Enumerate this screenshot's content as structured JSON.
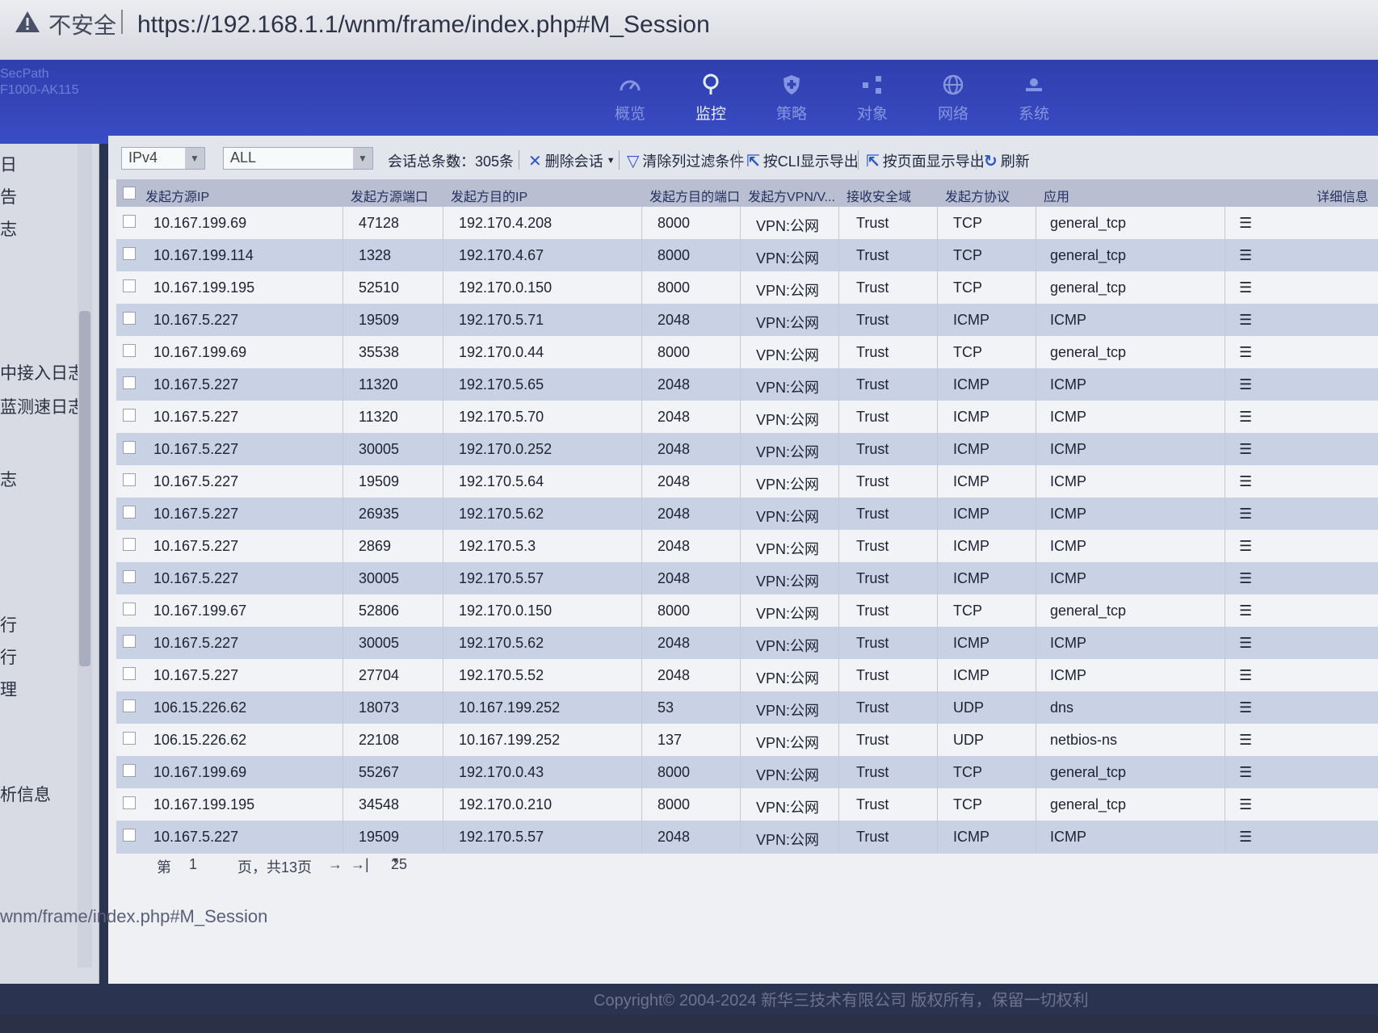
{
  "browser": {
    "insecure_label": "不安全",
    "url": "https://192.168.1.1/wnm/frame/index.php#M_Session"
  },
  "app": {
    "brand_line1": "SecPath",
    "brand_line2": "F1000-AK115"
  },
  "nav": [
    {
      "label": "概览",
      "icon": "dashboard-icon",
      "active": false
    },
    {
      "label": "监控",
      "icon": "location-pin-icon",
      "active": true
    },
    {
      "label": "策略",
      "icon": "shield-icon",
      "active": false
    },
    {
      "label": "对象",
      "icon": "network-nodes-icon",
      "active": false
    },
    {
      "label": "网络",
      "icon": "globe-icon",
      "active": false
    },
    {
      "label": "系统",
      "icon": "system-icon",
      "active": false
    }
  ],
  "sidebar": {
    "items": [
      "日",
      "告",
      "志",
      "中接入日志",
      "蓝测速日志",
      "志",
      "行",
      "行",
      "理",
      "析信息"
    ]
  },
  "toolbar": {
    "ip_version": "IPv4",
    "filter": "ALL",
    "session_count_label": "会话总条数",
    "session_count_value": "：305条",
    "delete_label": "删除会话",
    "clear_filter_label": "清除列过滤条件",
    "export_cli_label": "按CLI显示导出",
    "export_page_label": "按页面显示导出",
    "refresh_label": "刷新"
  },
  "table": {
    "headers": [
      "发起方源IP",
      "发起方源端口",
      "发起方目的IP",
      "发起方目的端口",
      "发起方VPN/V...",
      "接收安全域",
      "发起方协议",
      "应用",
      "详细信息"
    ],
    "rows": [
      [
        "10.167.199.69",
        "47128",
        "192.170.4.208",
        "8000",
        "VPN:公网",
        "Trust",
        "TCP",
        "general_tcp"
      ],
      [
        "10.167.199.114",
        "1328",
        "192.170.4.67",
        "8000",
        "VPN:公网",
        "Trust",
        "TCP",
        "general_tcp"
      ],
      [
        "10.167.199.195",
        "52510",
        "192.170.0.150",
        "8000",
        "VPN:公网",
        "Trust",
        "TCP",
        "general_tcp"
      ],
      [
        "10.167.5.227",
        "19509",
        "192.170.5.71",
        "2048",
        "VPN:公网",
        "Trust",
        "ICMP",
        "ICMP"
      ],
      [
        "10.167.199.69",
        "35538",
        "192.170.0.44",
        "8000",
        "VPN:公网",
        "Trust",
        "TCP",
        "general_tcp"
      ],
      [
        "10.167.5.227",
        "11320",
        "192.170.5.65",
        "2048",
        "VPN:公网",
        "Trust",
        "ICMP",
        "ICMP"
      ],
      [
        "10.167.5.227",
        "11320",
        "192.170.5.70",
        "2048",
        "VPN:公网",
        "Trust",
        "ICMP",
        "ICMP"
      ],
      [
        "10.167.5.227",
        "30005",
        "192.170.0.252",
        "2048",
        "VPN:公网",
        "Trust",
        "ICMP",
        "ICMP"
      ],
      [
        "10.167.5.227",
        "19509",
        "192.170.5.64",
        "2048",
        "VPN:公网",
        "Trust",
        "ICMP",
        "ICMP"
      ],
      [
        "10.167.5.227",
        "26935",
        "192.170.5.62",
        "2048",
        "VPN:公网",
        "Trust",
        "ICMP",
        "ICMP"
      ],
      [
        "10.167.5.227",
        "2869",
        "192.170.5.3",
        "2048",
        "VPN:公网",
        "Trust",
        "ICMP",
        "ICMP"
      ],
      [
        "10.167.5.227",
        "30005",
        "192.170.5.57",
        "2048",
        "VPN:公网",
        "Trust",
        "ICMP",
        "ICMP"
      ],
      [
        "10.167.199.67",
        "52806",
        "192.170.0.150",
        "8000",
        "VPN:公网",
        "Trust",
        "TCP",
        "general_tcp"
      ],
      [
        "10.167.5.227",
        "30005",
        "192.170.5.62",
        "2048",
        "VPN:公网",
        "Trust",
        "ICMP",
        "ICMP"
      ],
      [
        "10.167.5.227",
        "27704",
        "192.170.5.52",
        "2048",
        "VPN:公网",
        "Trust",
        "ICMP",
        "ICMP"
      ],
      [
        "106.15.226.62",
        "18073",
        "10.167.199.252",
        "53",
        "VPN:公网",
        "Trust",
        "UDP",
        "dns"
      ],
      [
        "106.15.226.62",
        "22108",
        "10.167.199.252",
        "137",
        "VPN:公网",
        "Trust",
        "UDP",
        "netbios-ns"
      ],
      [
        "10.167.199.69",
        "55267",
        "192.170.0.43",
        "8000",
        "VPN:公网",
        "Trust",
        "TCP",
        "general_tcp"
      ],
      [
        "10.167.199.195",
        "34548",
        "192.170.0.210",
        "8000",
        "VPN:公网",
        "Trust",
        "TCP",
        "general_tcp"
      ],
      [
        "10.167.5.227",
        "19509",
        "192.170.5.57",
        "2048",
        "VPN:公网",
        "Trust",
        "ICMP",
        "ICMP"
      ]
    ],
    "detail_glyph": "☰"
  },
  "pager": {
    "page_prefix": "第",
    "page_value": "1",
    "page_suffix": "页，共13页",
    "next": "→",
    "last": "→|",
    "page_size": "25"
  },
  "status_url": "wnm/frame/index.php#M_Session",
  "copyright": "Copyright© 2004-2024 新华三技术有限公司 版权所有，保留一切权利"
}
